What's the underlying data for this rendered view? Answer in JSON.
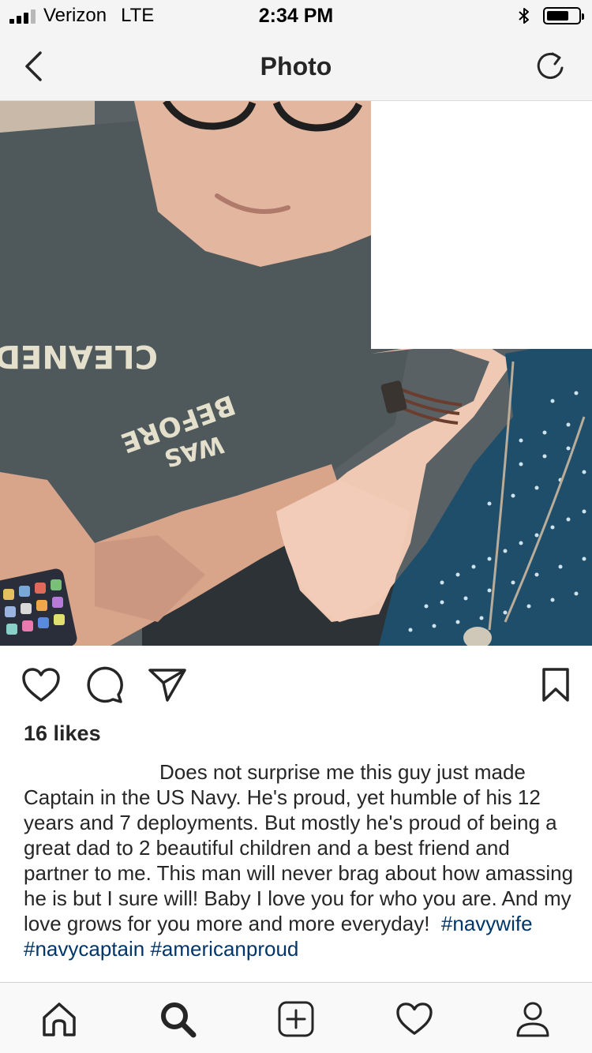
{
  "status_bar": {
    "carrier": "Verizon",
    "network": "LTE",
    "time": "2:34 PM",
    "battery_level": 0.7,
    "signal_bars": 3,
    "icons": [
      "signal-icon",
      "bluetooth-icon",
      "battery-icon"
    ]
  },
  "nav": {
    "title": "Photo",
    "back_icon": "chevron-left-icon",
    "refresh_icon": "refresh-icon"
  },
  "photo": {
    "shirt_text": [
      "CLEANED",
      "BEFORE",
      "WAS"
    ]
  },
  "actions": {
    "icons": [
      "heart-icon",
      "comment-icon",
      "send-icon",
      "bookmark-icon"
    ]
  },
  "post": {
    "likes": "16 likes",
    "caption_text": "Does not surprise me this guy just made Captain in the US Navy. He's proud, yet humble of his 12 years and 7 deployments. But mostly he's proud of being a great dad to 2 beautiful children and a best friend and partner to me. This man will never brag about how amassing he is but I sure will!  Baby I love you for who you are. And my love grows for you more and more everyday!",
    "hashtags": [
      "#navywife",
      "#navycaptain",
      "#americanproud"
    ]
  },
  "tab_bar": {
    "icons": [
      "home-icon",
      "search-icon",
      "new-post-icon",
      "activity-heart-icon",
      "profile-icon"
    ]
  },
  "colors": {
    "hashtag": "#003569",
    "text": "#262626",
    "bar_background": "#f4f4f4"
  }
}
